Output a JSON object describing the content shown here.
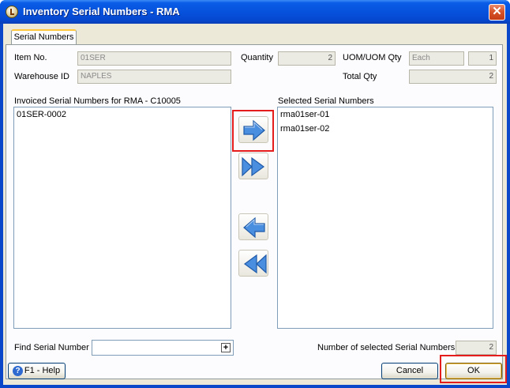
{
  "window": {
    "title": "Inventory Serial Numbers - RMA"
  },
  "tabs": [
    {
      "label": "Serial Numbers"
    }
  ],
  "form": {
    "item_no_label": "Item No.",
    "item_no_value": "01SER",
    "warehouse_label": "Warehouse ID",
    "warehouse_value": "NAPLES",
    "quantity_label": "Quantity",
    "quantity_value": "2",
    "uom_label": "UOM/UOM Qty",
    "uom_value": "Each",
    "uom_qty_value": "1",
    "total_qty_label": "Total Qty",
    "total_qty_value": "2"
  },
  "invoiced": {
    "label": "Invoiced Serial Numbers for RMA - C10005",
    "items": [
      "01SER-0002"
    ]
  },
  "selected": {
    "label": "Selected Serial Numbers",
    "items": [
      "rma01ser-01",
      "rma01ser-02"
    ]
  },
  "transfer_buttons": {
    "add_one": "arrow-right-icon",
    "add_all": "double-arrow-right-icon",
    "remove_one": "arrow-left-icon",
    "remove_all": "double-arrow-left-icon"
  },
  "find": {
    "label": "Find Serial Number",
    "value": ""
  },
  "summary": {
    "label": "Number of selected Serial Numbers",
    "value": "2"
  },
  "footer": {
    "help_label": "F1 - Help",
    "cancel_label": "Cancel",
    "ok_label": "OK"
  },
  "colors": {
    "title_bar": "#0a5ce6",
    "highlight": "#e41c1c",
    "arrow": "#4a8ee0"
  }
}
